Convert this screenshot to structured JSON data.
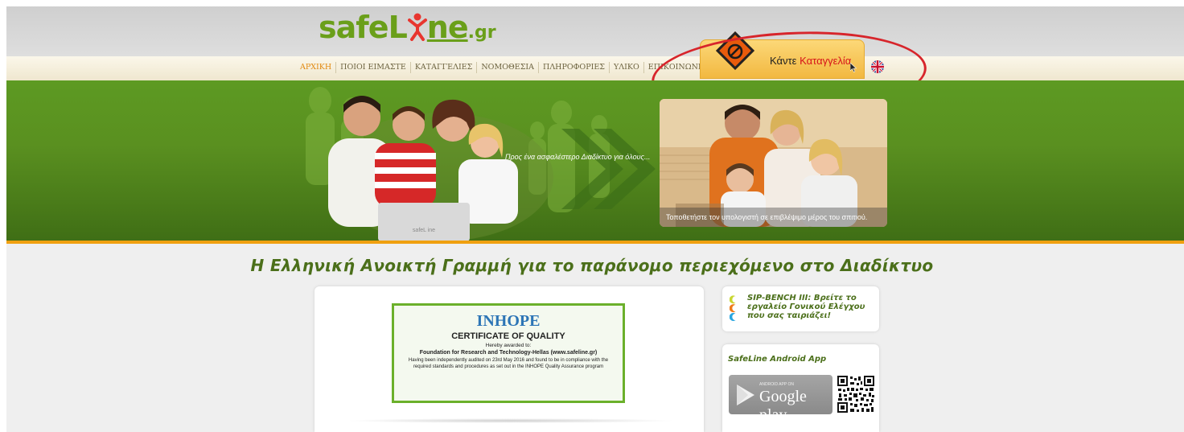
{
  "header": {
    "logo": {
      "part1": "safe",
      "part2": "L",
      "part3": "ne",
      "suffix": ".gr"
    },
    "nav": [
      {
        "label": "ΑΡΧΙΚΗ",
        "active": true
      },
      {
        "label": "ΠΟΙΟΙ ΕΙΜΑΣΤΕ",
        "active": false
      },
      {
        "label": "ΚΑΤΑΓΓΕΛΙΕΣ",
        "active": false
      },
      {
        "label": "ΝΟΜΟΘΕΣΙΑ",
        "active": false
      },
      {
        "label": "ΠΛΗΡΟΦΟΡΙΕΣ",
        "active": false
      },
      {
        "label": "ΥΛΙΚΟ",
        "active": false
      },
      {
        "label": "ΕΠΙΚΟΙΝΩΝΙΑ",
        "active": false
      }
    ],
    "report_button": {
      "word1": "Κάντε",
      "word2": "Καταγγελία"
    },
    "language_icon": "uk-flag-icon"
  },
  "banner": {
    "laptop_brand": "safeL ine",
    "slogan": "Προς ένα ασφαλέστερο Διαδίκτυο για όλους...",
    "photo_caption": "Τοποθετήστε τον υπολογιστή σε επιβλέψιμο μέρος του σπιτιού."
  },
  "main": {
    "heading": "Η Ελληνική Ανοικτή Γραμμή για το παράνομο περιεχόμενο στο Διαδίκτυο",
    "certificate": {
      "brand": "INHOPE",
      "title": "CERTIFICATE OF QUALITY",
      "awarded": "Hereby awarded to:",
      "organization": "Foundation for Research and Technology-Hellas (www.safeline.gr)",
      "body": "Having been independently audited on 23rd May 2016 and found to be in compliance with the required standards and procedures as set out in the INHOPE Quality Assurance program"
    }
  },
  "sidebar": {
    "sip_bench": {
      "line1": "SIP-BENCH III: Βρείτε το",
      "line2": "εργαλείο Γονικού Ελέγχου",
      "line3": "που σας ταιριάζει!"
    },
    "android": {
      "title": "SafeLine Android App",
      "badge_small": "ANDROID APP ON",
      "badge_big": "Google play"
    }
  },
  "colors": {
    "accent_green": "#6a9f1a",
    "nav_active": "#e28a12",
    "annotation_red": "#d7252b",
    "report_red": "#d7141a"
  }
}
